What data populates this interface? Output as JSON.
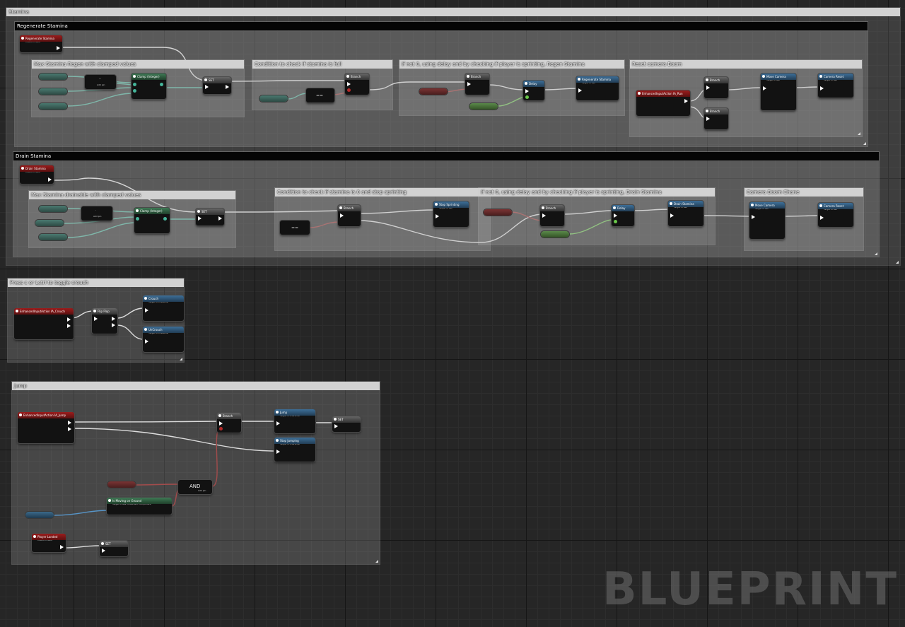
{
  "comments": {
    "stamina": "Stamina",
    "regenerate": "Regenerate Stamina",
    "regen_max": "Max Stamina Regen with clamped values",
    "regen_condition": "Condition to check if stamina is full",
    "regen_delay": "If not 0, using delay and by checking if player is sprinting, Regen Stamina",
    "regen_camera": "Reset camera Boom",
    "drain": "Drain Stamina",
    "drain_max": "Max Stamina drainable with clamped values",
    "drain_condition": "Condition to check if stamina is 0 and stop sprinting",
    "drain_delay": "If not 0, using delay and by checking if player is sprinting, Drain Stamina",
    "drain_camera": "Camera Boom Chane",
    "crouch": "Press c or Lctrl to toggle crouch",
    "jump": "Jump"
  },
  "nodes": {
    "regen_event": {
      "title": "Regenerate Stamina",
      "sub": "Custom Event"
    },
    "drain_event": {
      "title": "Drain Stamina",
      "sub": "Custom Event"
    },
    "landed_event": {
      "title": "Player Landed",
      "sub": "Custom Event"
    },
    "clamp": "Clamp (Integer)",
    "set": "SET",
    "branch": "Branch",
    "delay": "Delay",
    "regen_call": {
      "title": "Regenerate Stamina",
      "sub": "Target is Self"
    },
    "drain_call": {
      "title": "Drain Stamina",
      "sub": "Target is Self"
    },
    "stop_sprinting": {
      "title": "Stop Sprinting",
      "sub": "Target is Self"
    },
    "enh_run": "EnhancedInputAction IA_Run",
    "enh_crouch": "EnhancedInputAction IA_Crouch",
    "enh_jump": "EnhancedInputAction IA_Jump",
    "move_camera": {
      "title": "Move Camera",
      "sub": "Target is Self"
    },
    "camera_reset": {
      "title": "Camera Reset",
      "sub": "Target is Self"
    },
    "flip_flop": "Flip Flop",
    "crouch": {
      "title": "Crouch",
      "sub": "Target is Character"
    },
    "uncrouch": {
      "title": "UnCrouch",
      "sub": "Target is Character"
    },
    "jump": {
      "title": "Jump",
      "sub": "Target is Character"
    },
    "stop_jumping": {
      "title": "Stop Jumping",
      "sub": "Target is Character"
    },
    "moving_on_ground": {
      "title": "Is Moving on Ground",
      "sub": "Target is Nav Movement Component"
    },
    "and_label": "AND",
    "eq_label": "==",
    "add_pin": "Add pin",
    "minus": "-",
    "plus": "+"
  },
  "watermark": "BLUEPRINT",
  "colors": {
    "event_red": "#9b1c1c",
    "function_blue": "#3d6f98",
    "pure_green": "#3e7a55",
    "exec_white": "#ffffff"
  }
}
